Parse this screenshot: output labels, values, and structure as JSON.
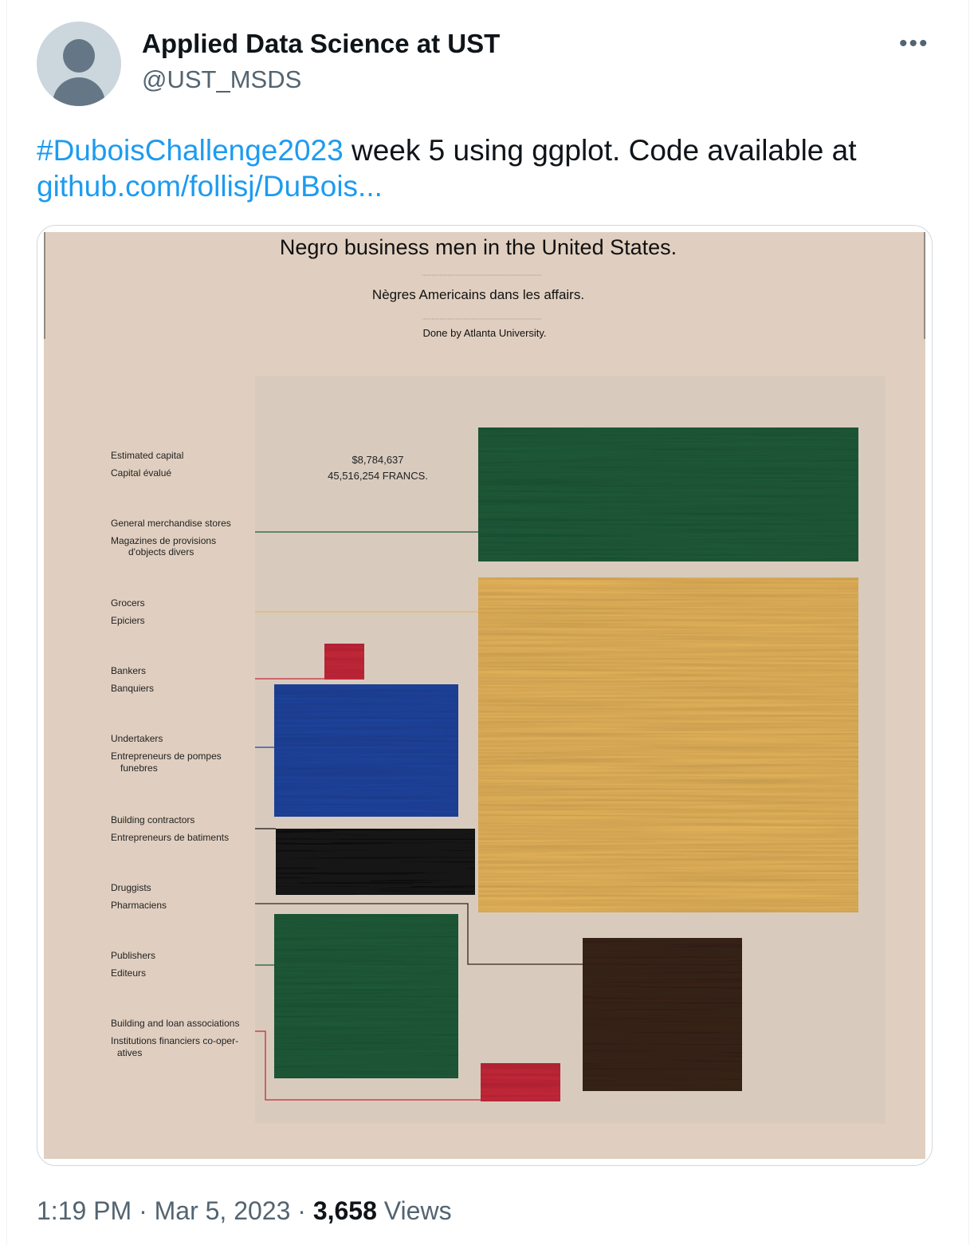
{
  "author": {
    "display_name": "Applied Data Science at UST",
    "handle": "@UST_MSDS"
  },
  "menu_icon": "more-horizontal-icon",
  "tweet": {
    "hashtag": "#DuboisChallenge2023",
    "text": " week 5 using ggplot.  Code available at",
    "link": "github.com/follisj/DuBois..."
  },
  "chart_data": {
    "type": "other",
    "title": "Negro business men in the United States.",
    "subtitle": "Nègres Americains dans les affairs.",
    "credit": "Done by Atlanta University.",
    "annotation": [
      "$8,784,637",
      "45,516,254 FRANCS."
    ],
    "categories": [
      {
        "en": "Estimated capital",
        "fr": "Capital évalué"
      },
      {
        "en": "General merchandise stores",
        "fr": [
          "Magazines de provisions",
          "d'objects divers"
        ],
        "color": "#1e5c3a"
      },
      {
        "en": "Grocers",
        "fr": "Epiciers",
        "color": "#e8b65c"
      },
      {
        "en": "Bankers",
        "fr": "Banquiers",
        "color": "#c8283a"
      },
      {
        "en": "Undertakers",
        "fr": [
          "Entrepreneurs de pompes",
          "funebres"
        ],
        "color": "#1f45a0"
      },
      {
        "en": "Building contractors",
        "fr": "Entrepreneurs de batiments",
        "color": "#151515"
      },
      {
        "en": "Druggists",
        "fr": "Pharmaciens",
        "color": "#3a2418"
      },
      {
        "en": "Publishers",
        "fr": "Editeurs",
        "color": "#1e5c3a"
      },
      {
        "en": "Building and loan associations",
        "fr": [
          "Institutions financiers co-oper-",
          "atives"
        ],
        "color": "#c8283a"
      }
    ]
  },
  "footer": {
    "time": "1:19 PM",
    "date": "Mar 5, 2023",
    "views_count": "3,658",
    "views_label": "Views"
  }
}
